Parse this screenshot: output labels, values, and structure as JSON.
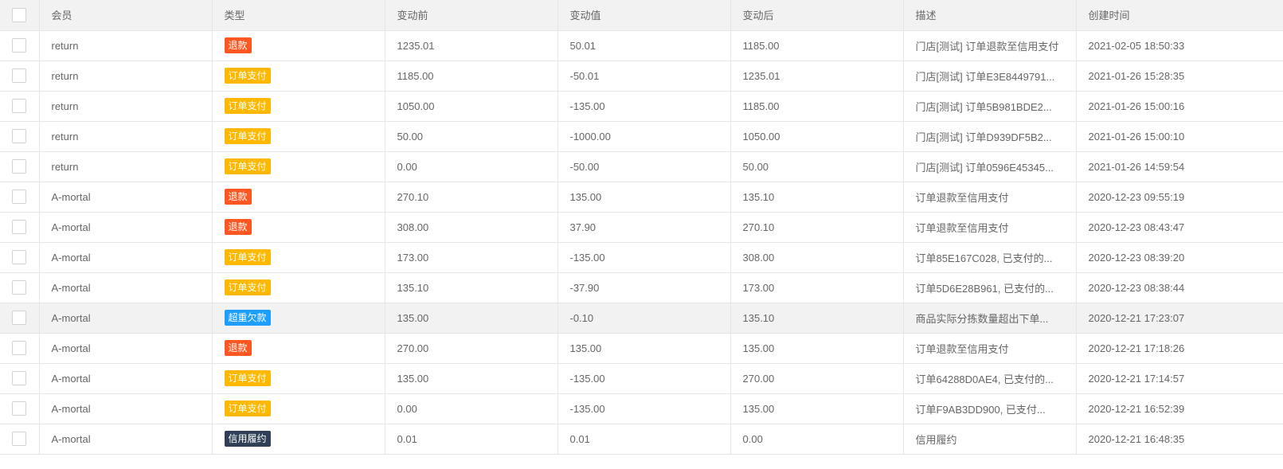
{
  "table": {
    "headers": [
      "会员",
      "类型",
      "变动前",
      "变动值",
      "变动后",
      "描述",
      "创建时间"
    ],
    "tag_colors": {
      "退款": "#ff5722",
      "订单支付": "#ffb800",
      "超重欠款": "#1e9fff",
      "信用履约": "#2f4056"
    },
    "rows": [
      {
        "member": "return",
        "type": "退款",
        "before": "1235.01",
        "change": "50.01",
        "after": "1185.00",
        "desc": "门店[测试] 订单退款至信用支付",
        "time": "2021-02-05 18:50:33"
      },
      {
        "member": "return",
        "type": "订单支付",
        "before": "1185.00",
        "change": "-50.01",
        "after": "1235.01",
        "desc": "门店[测试] 订单E3E8449791...",
        "time": "2021-01-26 15:28:35"
      },
      {
        "member": "return",
        "type": "订单支付",
        "before": "1050.00",
        "change": "-135.00",
        "after": "1185.00",
        "desc": "门店[测试] 订单5B981BDE2...",
        "time": "2021-01-26 15:00:16"
      },
      {
        "member": "return",
        "type": "订单支付",
        "before": "50.00",
        "change": "-1000.00",
        "after": "1050.00",
        "desc": "门店[测试] 订单D939DF5B2...",
        "time": "2021-01-26 15:00:10"
      },
      {
        "member": "return",
        "type": "订单支付",
        "before": "0.00",
        "change": "-50.00",
        "after": "50.00",
        "desc": "门店[测试] 订单0596E45345...",
        "time": "2021-01-26 14:59:54"
      },
      {
        "member": "A-mortal",
        "type": "退款",
        "before": "270.10",
        "change": "135.00",
        "after": "135.10",
        "desc": "订单退款至信用支付",
        "time": "2020-12-23 09:55:19"
      },
      {
        "member": "A-mortal",
        "type": "退款",
        "before": "308.00",
        "change": "37.90",
        "after": "270.10",
        "desc": "订单退款至信用支付",
        "time": "2020-12-23 08:43:47"
      },
      {
        "member": "A-mortal",
        "type": "订单支付",
        "before": "173.00",
        "change": "-135.00",
        "after": "308.00",
        "desc": "订单85E167C028, 已支付的...",
        "time": "2020-12-23 08:39:20"
      },
      {
        "member": "A-mortal",
        "type": "订单支付",
        "before": "135.10",
        "change": "-37.90",
        "after": "173.00",
        "desc": "订单5D6E28B961, 已支付的...",
        "time": "2020-12-23 08:38:44"
      },
      {
        "member": "A-mortal",
        "type": "超重欠款",
        "before": "135.00",
        "change": "-0.10",
        "after": "135.10",
        "desc": "商品实际分拣数量超出下单...",
        "time": "2020-12-21 17:23:07",
        "hovered": true
      },
      {
        "member": "A-mortal",
        "type": "退款",
        "before": "270.00",
        "change": "135.00",
        "after": "135.00",
        "desc": "订单退款至信用支付",
        "time": "2020-12-21 17:18:26"
      },
      {
        "member": "A-mortal",
        "type": "订单支付",
        "before": "135.00",
        "change": "-135.00",
        "after": "270.00",
        "desc": "订单64288D0AE4, 已支付的...",
        "time": "2020-12-21 17:14:57"
      },
      {
        "member": "A-mortal",
        "type": "订单支付",
        "before": "0.00",
        "change": "-135.00",
        "after": "135.00",
        "desc": "订单F9AB3DD900, 已支付...",
        "time": "2020-12-21 16:52:39"
      },
      {
        "member": "A-mortal",
        "type": "信用履约",
        "before": "0.01",
        "change": "0.01",
        "after": "0.00",
        "desc": "信用履约",
        "time": "2020-12-21 16:48:35"
      }
    ]
  }
}
